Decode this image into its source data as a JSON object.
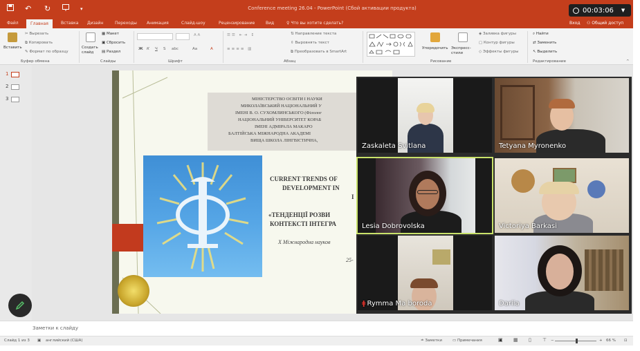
{
  "window": {
    "title": "Conference meeting 26.04 - PowerPoint (Сбой активации продукта)",
    "timer": "00:03:06"
  },
  "quick_access": {
    "save_icon": "save-icon",
    "undo_icon": "undo-icon",
    "redo_icon": "redo-icon",
    "present_icon": "present-icon"
  },
  "tabs": [
    "Файл",
    "Главная",
    "Вставка",
    "Дизайн",
    "Переходы",
    "Анимация",
    "Слайд-шоу",
    "Рецензирование",
    "Вид"
  ],
  "tell_me": "Что вы хотите сделать?",
  "account": {
    "login": "Вход",
    "share": "Общий доступ"
  },
  "ribbon": {
    "clipboard": {
      "paste": "Вставить",
      "cut": "Вырезать",
      "copy": "Копировать",
      "format": "Формат по образцу",
      "label": "Буфер обмена"
    },
    "slides": {
      "new": "Создать слайд",
      "layout": "Макет",
      "reset": "Сбросить",
      "section": "Раздел",
      "label": "Слайды"
    },
    "font": {
      "label": "Шрифт",
      "bold": "Ж",
      "italic": "К",
      "underline": "Ч",
      "strike": "S",
      "spacing": "abc",
      "size_up": "Aa"
    },
    "paragraph": {
      "label": "Абзац",
      "direction": "Направление текста",
      "align": "Выровнять текст",
      "smartart": "Преобразовать в SmartArt"
    },
    "drawing": {
      "label": "Рисование",
      "arrange": "Упорядочить",
      "quick_styles": "Экспресс-стили",
      "fill": "Заливка фигуры",
      "outline": "Контур фигуры",
      "effects": "Эффекты фигуры"
    },
    "editing": {
      "label": "Редактирование",
      "find": "Найти",
      "replace": "Заменить",
      "select": "Выделить"
    }
  },
  "thumbnails": [
    "1",
    "2",
    "3"
  ],
  "slide": {
    "header_lines": [
      "МІНІСТЕРСТВО ОСВІТИ І НАУКИ",
      "МИКОЛАЇВСЬКИЙ НАЦІОНАЛЬНИЙ У",
      "ІМЕНІ В. О. СУХОМЛИНСЬКОГО (Філолог",
      "НАЦІОНАЛЬНИЙ УНІВЕРСИТЕТ КОРАБ",
      "ІМЕНІ АДМІРАЛА МАКАРО",
      "БАЛТІЙСЬКА МІЖНАРОДНА АКАДЕМІ",
      "ВИЩА ШКОЛА ЛІНГВІСТИЧНА,"
    ],
    "title_lines": [
      "CURRENT TRENDS OF",
      "DEVELOPMENT IN",
      "I"
    ],
    "ua_title_lines": [
      "«ТЕНДЕНЦІЇ РОЗВИ",
      "КОНТЕКСТІ ІНТЕГРА"
    ],
    "conference": "X Міжнародна науков",
    "date": "25-"
  },
  "participants": [
    {
      "name": "Zaskaleta Svitlana",
      "muted": false,
      "speaking": false
    },
    {
      "name": "Tetyana Myronenko",
      "muted": false,
      "speaking": false
    },
    {
      "name": "Lesia Dobrovolska",
      "muted": false,
      "speaking": true
    },
    {
      "name": "Victoriya Barkasi",
      "muted": false,
      "speaking": false
    },
    {
      "name": "Rymma Ma boroda",
      "muted": true,
      "speaking": false
    },
    {
      "name": "Dariia",
      "muted": false,
      "speaking": false
    }
  ],
  "notes": {
    "placeholder": "Заметки к слайду"
  },
  "status": {
    "slide": "Слайд 1 из 3",
    "language": "английский (США)",
    "notes": "Заметки",
    "comments": "Примечания",
    "zoom": "66 %"
  }
}
